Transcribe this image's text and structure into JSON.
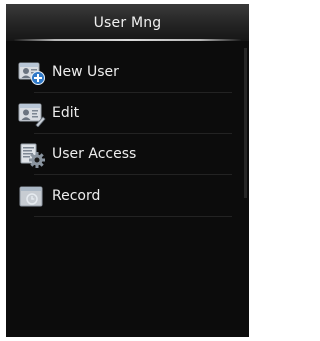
{
  "header": {
    "title": "User Mng"
  },
  "menu": {
    "items": [
      {
        "label": "New User",
        "icon": "add-user-icon"
      },
      {
        "label": "Edit",
        "icon": "edit-user-icon"
      },
      {
        "label": "User Access",
        "icon": "user-access-gear-icon"
      },
      {
        "label": "Record",
        "icon": "record-icon"
      }
    ]
  },
  "colors": {
    "screen_background": "#0c0c0c",
    "text": "#ededed",
    "header_gradient_top": "#3a3a3a",
    "icon_blue": "#2f79c8"
  }
}
